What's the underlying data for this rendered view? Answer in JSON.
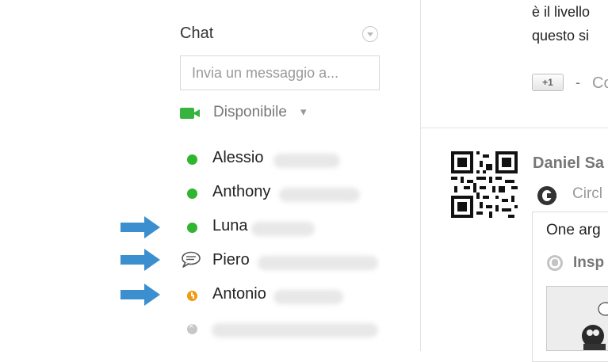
{
  "chat": {
    "title": "Chat",
    "search_placeholder": "Invia un messaggio a...",
    "status": {
      "label": "Disponibile",
      "caret": "▾"
    },
    "contacts": [
      {
        "name": "Alessio",
        "state": "online"
      },
      {
        "name": "Anthony",
        "state": "online"
      },
      {
        "name": "Luna",
        "state": "online"
      },
      {
        "name": "Piero",
        "state": "chat-bubble"
      },
      {
        "name": "Antonio",
        "state": "idle"
      },
      {
        "name": "",
        "state": "offline"
      }
    ]
  },
  "feed": {
    "post_line1": "è il livello",
    "post_line2": "questo si",
    "plus_one": "+1",
    "separator": "-",
    "comment_link": "Co",
    "author": "Daniel Sa",
    "circle_label": "Circl",
    "share_text": "One arg",
    "insp_text": "Insp"
  },
  "colors": {
    "online": "#2fb52f",
    "idle": "#f09a12",
    "offline": "#c7c7c7",
    "arrow": "#3b8fcf"
  }
}
